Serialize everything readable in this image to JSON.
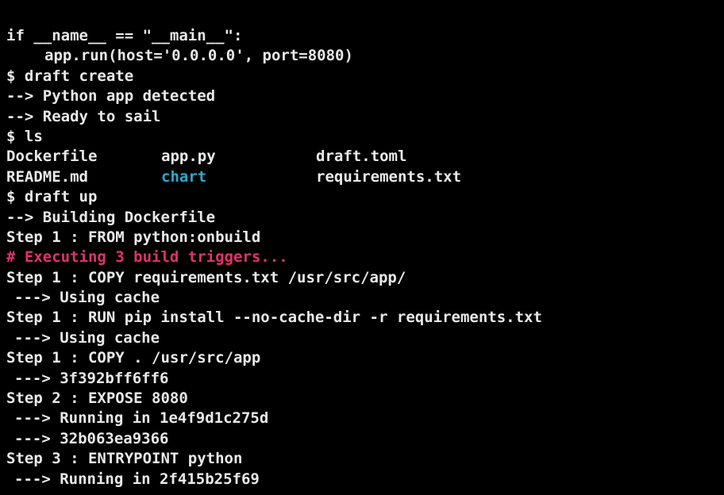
{
  "colors": {
    "background": "#000000",
    "text": "#e9e9e9",
    "comment": "#e0326a",
    "directory": "#2aa9cf"
  },
  "lines": {
    "l01": "if __name__ == \"__main__\":",
    "l02": "app.run(host='0.0.0.0', port=8080)",
    "l03": "$ draft create",
    "l04": "--> Python app detected",
    "l05": "--> Ready to sail",
    "l06": "$ ls",
    "l09": "$ draft up",
    "l10": "--> Building Dockerfile",
    "l11": "Step 1 : FROM python:onbuild",
    "l12": "# Executing 3 build triggers...",
    "l13": "Step 1 : COPY requirements.txt /usr/src/app/",
    "l14": "---> Using cache",
    "l15": "Step 1 : RUN pip install --no-cache-dir -r requirements.txt",
    "l16": "---> Using cache",
    "l17": "Step 1 : COPY . /usr/src/app",
    "l18": "---> 3f392bff6ff6",
    "l19": "Step 2 : EXPOSE 8080",
    "l20": "---> Running in 1e4f9d1c275d",
    "l21": "---> 32b063ea9366",
    "l22": "Step 3 : ENTRYPOINT python",
    "l23": "---> Running in 2f415b25f69"
  },
  "ls_output": {
    "row1": [
      "Dockerfile",
      "app.py",
      "draft.toml"
    ],
    "row2": [
      "README.md",
      "chart",
      "requirements.txt"
    ]
  }
}
